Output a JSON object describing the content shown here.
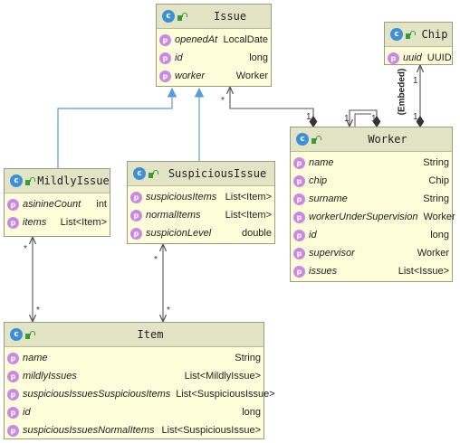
{
  "colors": {
    "header": "#e3e4c5",
    "body": "#fdfdd9",
    "border": "#9c9c86",
    "inheritance": "#5b9bd5",
    "association": "#555555",
    "class_icon": "#3d8fd6",
    "field_icon": "#c98ae0"
  },
  "icons": {
    "class_icon": "class-c-icon",
    "lock_icon": "lock-icon",
    "field_icon": "property-p-icon"
  },
  "icon_letters": {
    "class": "c",
    "field": "p"
  },
  "classes": {
    "issue": {
      "name": "Issue",
      "fields": [
        {
          "name": "openedAt",
          "type": "LocalDate"
        },
        {
          "name": "id",
          "type": "long"
        },
        {
          "name": "worker",
          "type": "Worker"
        }
      ]
    },
    "chip": {
      "name": "Chip",
      "fields": [
        {
          "name": "uuid",
          "type": "UUID"
        }
      ]
    },
    "worker": {
      "name": "Worker",
      "fields": [
        {
          "name": "name",
          "type": "String"
        },
        {
          "name": "chip",
          "type": "Chip"
        },
        {
          "name": "surname",
          "type": "String"
        },
        {
          "name": "workerUnderSupervision",
          "type": "Worker"
        },
        {
          "name": "id",
          "type": "long"
        },
        {
          "name": "supervisor",
          "type": "Worker"
        },
        {
          "name": "issues",
          "type": "List<Issue>"
        }
      ]
    },
    "mildly_issue": {
      "name": "MildlyIssue",
      "fields": [
        {
          "name": "asinineCount",
          "type": "int"
        },
        {
          "name": "items",
          "type": "List<Item>"
        }
      ]
    },
    "suspicious_issue": {
      "name": "SuspiciousIssue",
      "fields": [
        {
          "name": "suspiciousItems",
          "type": "List<Item>"
        },
        {
          "name": "normalItems",
          "type": "List<Item>"
        },
        {
          "name": "suspicionLevel",
          "type": "double"
        }
      ]
    },
    "item": {
      "name": "Item",
      "fields": [
        {
          "name": "name",
          "type": "String"
        },
        {
          "name": "mildlyIssues",
          "type": "List<MildlyIssue>"
        },
        {
          "name": "suspiciousIssuesSuspiciousItems",
          "type": "List<SuspiciousIssue>"
        },
        {
          "name": "id",
          "type": "long"
        },
        {
          "name": "suspiciousIssuesNormalItems",
          "type": "List<SuspiciousIssue>"
        }
      ]
    }
  },
  "multiplicities": {
    "issue_worker_star": "*",
    "issue_worker_one": "1",
    "worker_self_one_a": "1",
    "worker_self_one_b": "1",
    "chip_one_top": "1",
    "chip_one_bottom": "1",
    "mildly_star": "*",
    "mildly_item_star": "*",
    "suspicious_star": "*",
    "suspicious_item_star": "*"
  },
  "embedded_label": "(Embeded)"
}
